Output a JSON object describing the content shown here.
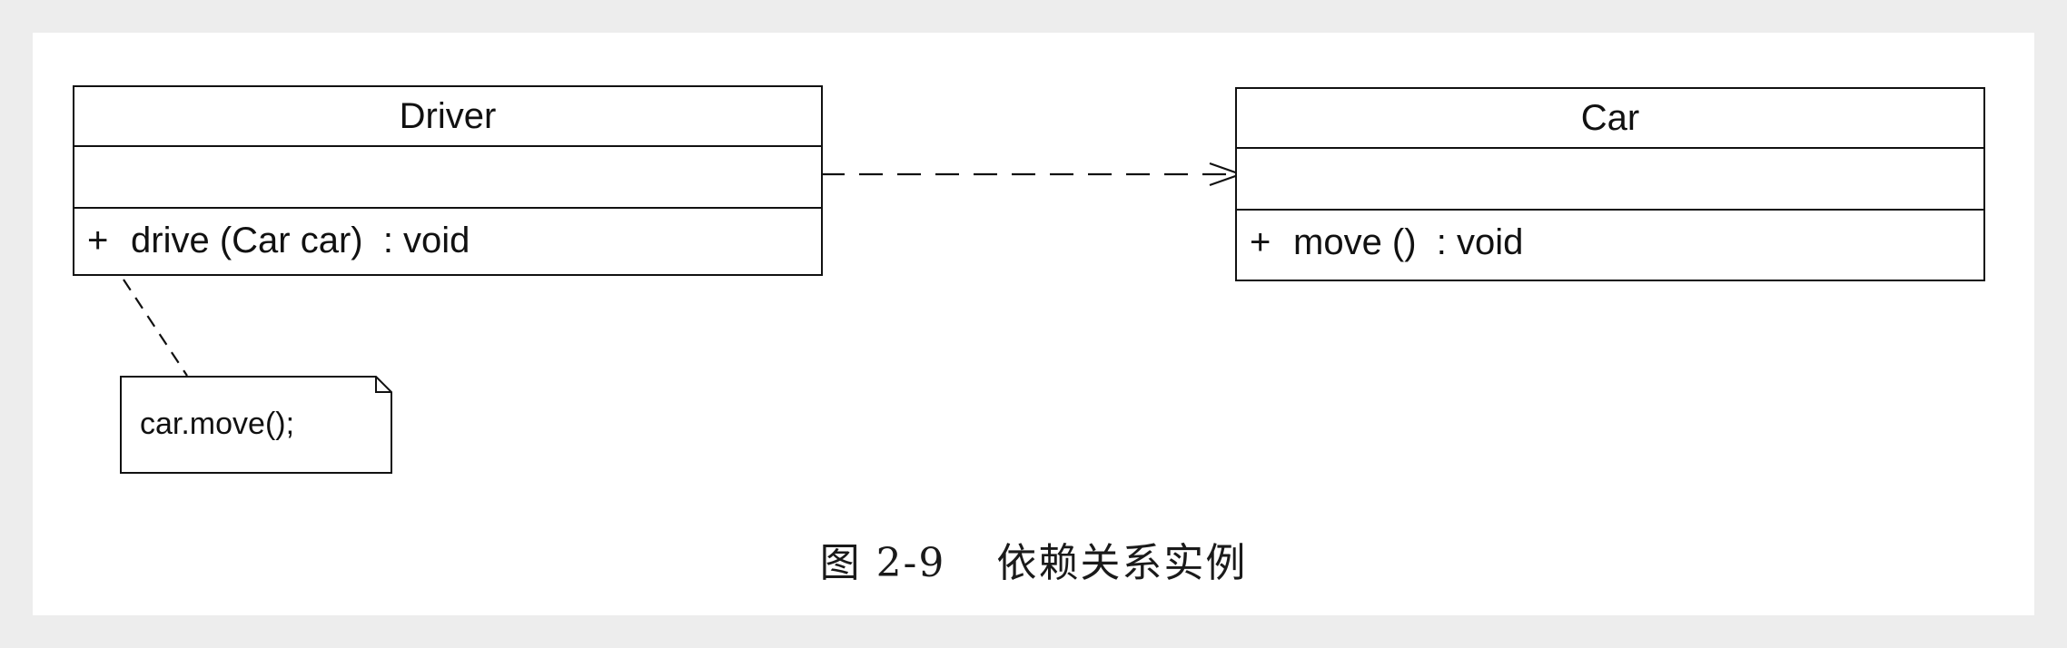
{
  "diagram": {
    "type": "uml-class-diagram",
    "relationship": "dependency",
    "classes": [
      {
        "name": "Driver",
        "attributes": [],
        "operations": [
          {
            "visibility": "+",
            "signature": "drive (Car car)  : void"
          }
        ]
      },
      {
        "name": "Car",
        "attributes": [],
        "operations": [
          {
            "visibility": "+",
            "signature": "move ()  : void"
          }
        ]
      }
    ],
    "note": {
      "text": "car.move();"
    },
    "caption": {
      "number": "图 2-9",
      "title": "依赖关系实例"
    }
  }
}
